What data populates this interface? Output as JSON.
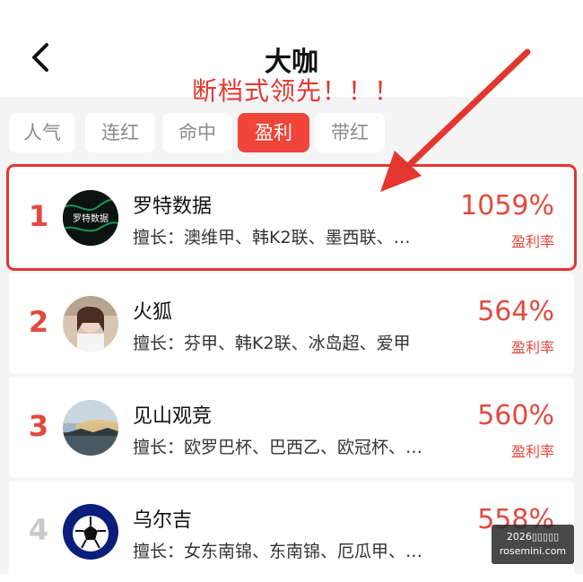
{
  "header": {
    "title": "大咖",
    "annotation": "断档式领先！！！"
  },
  "tabs": [
    {
      "label": "人气",
      "active": false
    },
    {
      "label": "连红",
      "active": false
    },
    {
      "label": "命中",
      "active": false
    },
    {
      "label": "盈利",
      "active": true
    },
    {
      "label": "带红",
      "active": false
    }
  ],
  "list": [
    {
      "rank": "1",
      "name": "罗特数据",
      "avatar_text": "罗特数据",
      "expertise_label": "擅长：",
      "expertise": "澳维甲、韩K2联、墨西联、…",
      "percent": "1059%",
      "percent_label": "盈利率"
    },
    {
      "rank": "2",
      "name": "火狐",
      "expertise_label": "擅长：",
      "expertise": "芬甲、韩K2联、冰岛超、爱甲",
      "percent": "564%",
      "percent_label": "盈利率"
    },
    {
      "rank": "3",
      "name": "见山观竞",
      "expertise_label": "擅长：",
      "expertise": "欧罗巴杯、巴西乙、欧冠杯、…",
      "percent": "560%",
      "percent_label": "盈利率"
    },
    {
      "rank": "4",
      "name": "乌尔吉",
      "expertise_label": "擅长：",
      "expertise": "女东南锦、东南锦、厄瓜甲、…",
      "percent": "558%",
      "percent_label": ""
    }
  ],
  "watermark": {
    "line1": "2026▯▯▯▯▯",
    "line2": "rosemini.com"
  },
  "colors": {
    "accent": "#e14a3f",
    "annotation_red": "#e3362e",
    "tab_active": "#f0453a"
  }
}
